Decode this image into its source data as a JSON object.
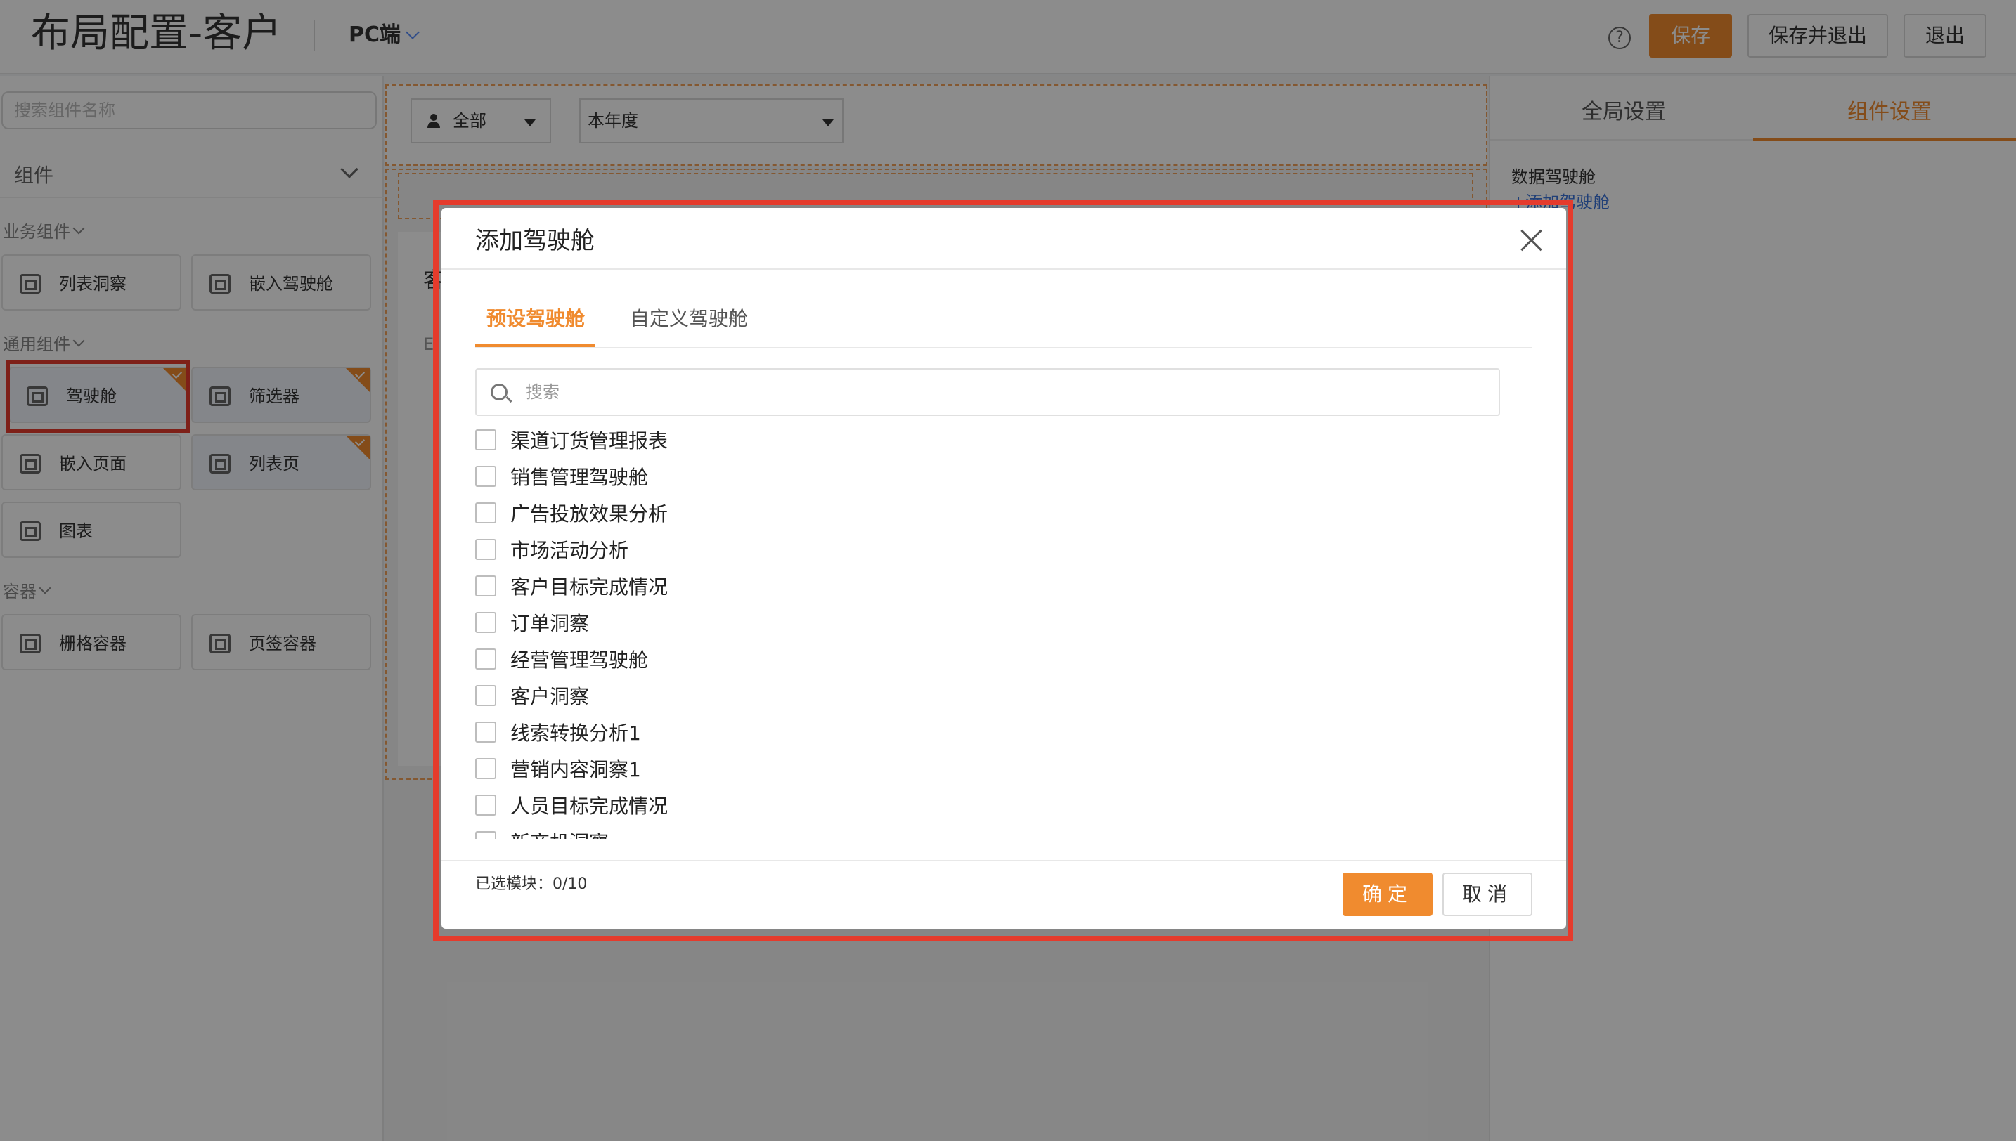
{
  "header": {
    "title": "布局配置-客户",
    "platform": "PC端",
    "help": "?",
    "save_label": "保存",
    "save_exit_label": "保存并退出",
    "exit_label": "退出"
  },
  "left": {
    "search_placeholder": "搜索组件名称",
    "components_label": "组件",
    "groups": [
      {
        "label": "业务组件",
        "items": [
          "列表洞察",
          "嵌入驾驶舱"
        ]
      },
      {
        "label": "通用组件",
        "items": [
          "驾驶舱",
          "筛选器",
          "嵌入页面",
          "列表页",
          "图表"
        ]
      },
      {
        "label": "容器",
        "items": [
          "栅格容器",
          "页签容器"
        ]
      }
    ]
  },
  "canvas": {
    "filter_scope": "全部",
    "filter_period": "本年度",
    "card_title": "客",
    "card_sub": "E"
  },
  "right": {
    "tabs": [
      "全局设置",
      "组件设置"
    ],
    "section_label": "数据驾驶舱",
    "add_link": "+添加驾驶舱"
  },
  "modal": {
    "title": "添加驾驶舱",
    "tabs": [
      "预设驾驶舱",
      "自定义驾驶舱"
    ],
    "search_placeholder": "搜索",
    "items": [
      "渠道订货管理报表",
      "销售管理驾驶舱",
      "广告投放效果分析",
      "市场活动分析",
      "客户目标完成情况",
      "订单洞察",
      "经营管理驾驶舱",
      "客户洞察",
      "线索转换分析1",
      "营销内容洞察1",
      "人员目标完成情况",
      "新商机洞察"
    ],
    "selected_label": "已选模块：",
    "selected_count": "0/10",
    "ok_label": "确定",
    "cancel_label": "取消"
  },
  "colors": {
    "accent": "#f08b2f",
    "highlight": "#e53b2c",
    "link": "#3b73d9"
  }
}
